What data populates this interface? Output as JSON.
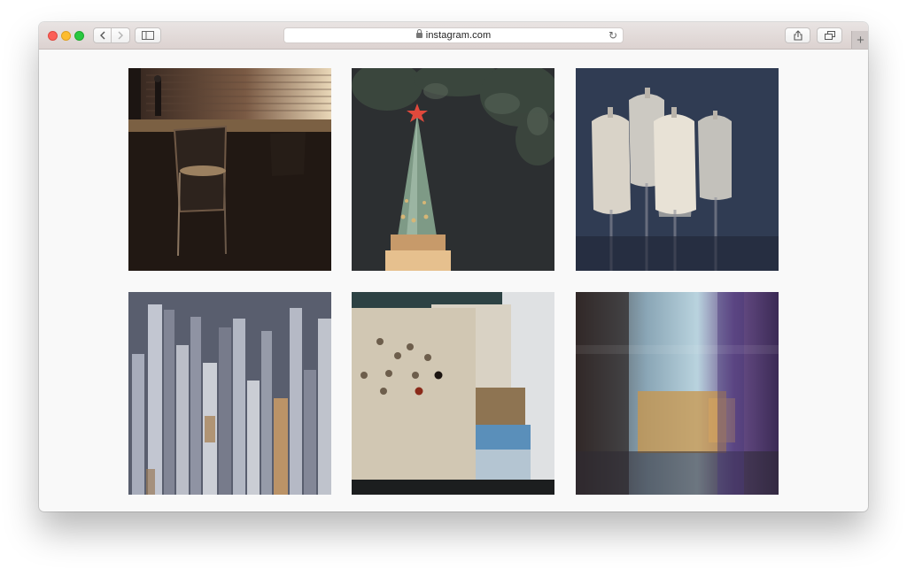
{
  "browser": {
    "url_text": "instagram.com"
  },
  "toolbar": {
    "back_icon": "chevron-left-icon",
    "forward_icon": "chevron-right-icon",
    "sidebar_icon": "sidebar-icon",
    "share_icon": "share-icon",
    "tabs_icon": "tabs-overview-icon",
    "reload_icon": "reload-icon",
    "newtab_label": "+"
  },
  "colors": {
    "close": "#fc5f57",
    "minimize": "#fdbc2e",
    "zoom": "#29c840"
  },
  "photos": [
    {
      "subject": "chair-by-window"
    },
    {
      "subject": "kremlin-tower-star"
    },
    {
      "subject": "mannequins"
    },
    {
      "subject": "wooden-planks"
    },
    {
      "subject": "perforated-board-and-boxes"
    },
    {
      "subject": "blurred-window-glass"
    }
  ]
}
